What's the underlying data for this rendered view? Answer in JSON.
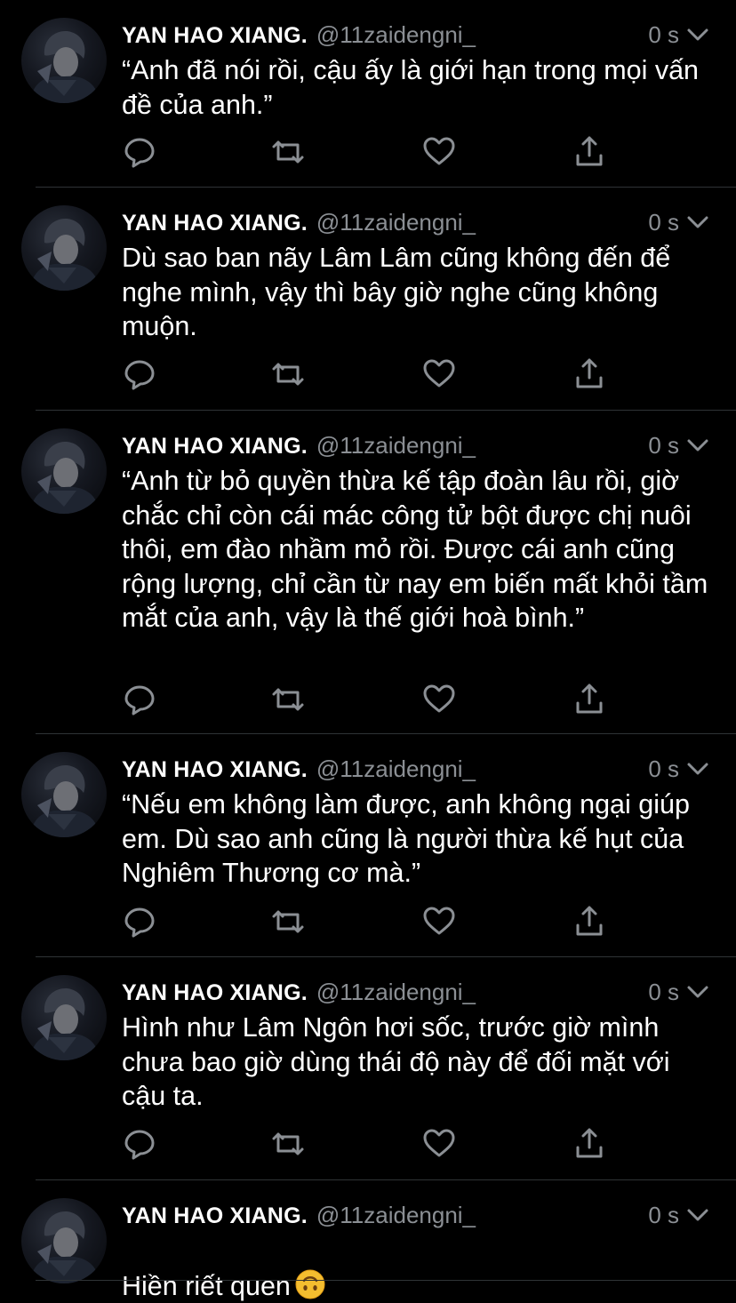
{
  "colors": {
    "background": "#000000",
    "text": "#ffffff",
    "secondary": "#8b8f94",
    "divider": "#2f3336"
  },
  "tweets": [
    {
      "name": "YAN HAO XIANG.",
      "handle": "@11zaidengni_",
      "time": "0 s",
      "text": "“Anh đã nói rồi, cậu ấy là giới hạn trong mọi vấn đề của anh.”"
    },
    {
      "name": "YAN HAO XIANG.",
      "handle": "@11zaidengni_",
      "time": "0 s",
      "text": "Dù sao ban nãy Lâm Lâm cũng không đến để nghe mình, vậy thì bây giờ nghe cũng không muộn."
    },
    {
      "name": "YAN HAO XIANG.",
      "handle": "@11zaidengni_",
      "time": "0 s",
      "text": "“Anh từ bỏ quyền thừa kế tập đoàn lâu rồi, giờ chắc chỉ còn cái mác công tử bột được chị nuôi thôi, em đào nhầm mỏ rồi. Được cái anh cũng rộng lượng, chỉ cần từ nay em biến mất khỏi tầm mắt của anh, vậy là thế giới hoà bình.”"
    },
    {
      "name": "YAN HAO XIANG.",
      "handle": "@11zaidengni_",
      "time": "0 s",
      "text": "“Nếu em không làm được, anh không ngại giúp em. Dù sao anh cũng là người thừa kế hụt của Nghiêm Thương cơ mà.”"
    },
    {
      "name": "YAN HAO XIANG.",
      "handle": "@11zaidengni_",
      "time": "0 s",
      "text": "Hình như Lâm Ngôn hơi sốc, trước giờ mình chưa bao giờ dùng thái độ này để đối mặt với cậu ta."
    },
    {
      "name": "YAN HAO XIANG.",
      "handle": "@11zaidengni_",
      "time": "0 s",
      "text": "Hiền riết quen",
      "emoji": "upside-down-face"
    }
  ],
  "icons": {
    "reply": "reply-icon",
    "retweet": "retweet-icon",
    "like": "heart-icon",
    "share": "share-icon",
    "more": "chevron-down-icon"
  }
}
